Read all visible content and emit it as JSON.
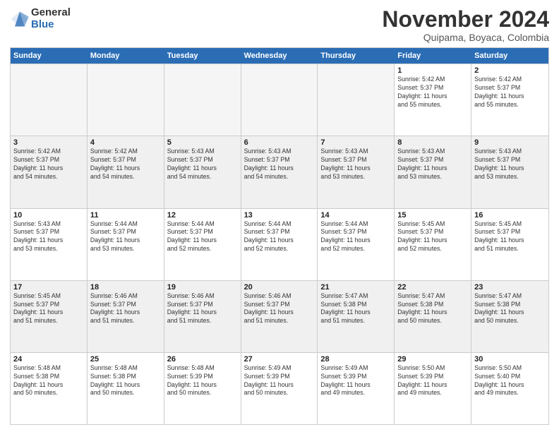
{
  "logo": {
    "general": "General",
    "blue": "Blue"
  },
  "title": "November 2024",
  "subtitle": "Quipama, Boyaca, Colombia",
  "header_days": [
    "Sunday",
    "Monday",
    "Tuesday",
    "Wednesday",
    "Thursday",
    "Friday",
    "Saturday"
  ],
  "weeks": [
    [
      {
        "day": "",
        "info": "",
        "empty": true
      },
      {
        "day": "",
        "info": "",
        "empty": true
      },
      {
        "day": "",
        "info": "",
        "empty": true
      },
      {
        "day": "",
        "info": "",
        "empty": true
      },
      {
        "day": "",
        "info": "",
        "empty": true
      },
      {
        "day": "1",
        "info": "Sunrise: 5:42 AM\nSunset: 5:37 PM\nDaylight: 11 hours\nand 55 minutes."
      },
      {
        "day": "2",
        "info": "Sunrise: 5:42 AM\nSunset: 5:37 PM\nDaylight: 11 hours\nand 55 minutes."
      }
    ],
    [
      {
        "day": "3",
        "info": "Sunrise: 5:42 AM\nSunset: 5:37 PM\nDaylight: 11 hours\nand 54 minutes."
      },
      {
        "day": "4",
        "info": "Sunrise: 5:42 AM\nSunset: 5:37 PM\nDaylight: 11 hours\nand 54 minutes."
      },
      {
        "day": "5",
        "info": "Sunrise: 5:43 AM\nSunset: 5:37 PM\nDaylight: 11 hours\nand 54 minutes."
      },
      {
        "day": "6",
        "info": "Sunrise: 5:43 AM\nSunset: 5:37 PM\nDaylight: 11 hours\nand 54 minutes."
      },
      {
        "day": "7",
        "info": "Sunrise: 5:43 AM\nSunset: 5:37 PM\nDaylight: 11 hours\nand 53 minutes."
      },
      {
        "day": "8",
        "info": "Sunrise: 5:43 AM\nSunset: 5:37 PM\nDaylight: 11 hours\nand 53 minutes."
      },
      {
        "day": "9",
        "info": "Sunrise: 5:43 AM\nSunset: 5:37 PM\nDaylight: 11 hours\nand 53 minutes."
      }
    ],
    [
      {
        "day": "10",
        "info": "Sunrise: 5:43 AM\nSunset: 5:37 PM\nDaylight: 11 hours\nand 53 minutes."
      },
      {
        "day": "11",
        "info": "Sunrise: 5:44 AM\nSunset: 5:37 PM\nDaylight: 11 hours\nand 53 minutes."
      },
      {
        "day": "12",
        "info": "Sunrise: 5:44 AM\nSunset: 5:37 PM\nDaylight: 11 hours\nand 52 minutes."
      },
      {
        "day": "13",
        "info": "Sunrise: 5:44 AM\nSunset: 5:37 PM\nDaylight: 11 hours\nand 52 minutes."
      },
      {
        "day": "14",
        "info": "Sunrise: 5:44 AM\nSunset: 5:37 PM\nDaylight: 11 hours\nand 52 minutes."
      },
      {
        "day": "15",
        "info": "Sunrise: 5:45 AM\nSunset: 5:37 PM\nDaylight: 11 hours\nand 52 minutes."
      },
      {
        "day": "16",
        "info": "Sunrise: 5:45 AM\nSunset: 5:37 PM\nDaylight: 11 hours\nand 51 minutes."
      }
    ],
    [
      {
        "day": "17",
        "info": "Sunrise: 5:45 AM\nSunset: 5:37 PM\nDaylight: 11 hours\nand 51 minutes."
      },
      {
        "day": "18",
        "info": "Sunrise: 5:46 AM\nSunset: 5:37 PM\nDaylight: 11 hours\nand 51 minutes."
      },
      {
        "day": "19",
        "info": "Sunrise: 5:46 AM\nSunset: 5:37 PM\nDaylight: 11 hours\nand 51 minutes."
      },
      {
        "day": "20",
        "info": "Sunrise: 5:46 AM\nSunset: 5:37 PM\nDaylight: 11 hours\nand 51 minutes."
      },
      {
        "day": "21",
        "info": "Sunrise: 5:47 AM\nSunset: 5:38 PM\nDaylight: 11 hours\nand 51 minutes."
      },
      {
        "day": "22",
        "info": "Sunrise: 5:47 AM\nSunset: 5:38 PM\nDaylight: 11 hours\nand 50 minutes."
      },
      {
        "day": "23",
        "info": "Sunrise: 5:47 AM\nSunset: 5:38 PM\nDaylight: 11 hours\nand 50 minutes."
      }
    ],
    [
      {
        "day": "24",
        "info": "Sunrise: 5:48 AM\nSunset: 5:38 PM\nDaylight: 11 hours\nand 50 minutes."
      },
      {
        "day": "25",
        "info": "Sunrise: 5:48 AM\nSunset: 5:38 PM\nDaylight: 11 hours\nand 50 minutes."
      },
      {
        "day": "26",
        "info": "Sunrise: 5:48 AM\nSunset: 5:39 PM\nDaylight: 11 hours\nand 50 minutes."
      },
      {
        "day": "27",
        "info": "Sunrise: 5:49 AM\nSunset: 5:39 PM\nDaylight: 11 hours\nand 50 minutes."
      },
      {
        "day": "28",
        "info": "Sunrise: 5:49 AM\nSunset: 5:39 PM\nDaylight: 11 hours\nand 49 minutes."
      },
      {
        "day": "29",
        "info": "Sunrise: 5:50 AM\nSunset: 5:39 PM\nDaylight: 11 hours\nand 49 minutes."
      },
      {
        "day": "30",
        "info": "Sunrise: 5:50 AM\nSunset: 5:40 PM\nDaylight: 11 hours\nand 49 minutes."
      }
    ]
  ]
}
